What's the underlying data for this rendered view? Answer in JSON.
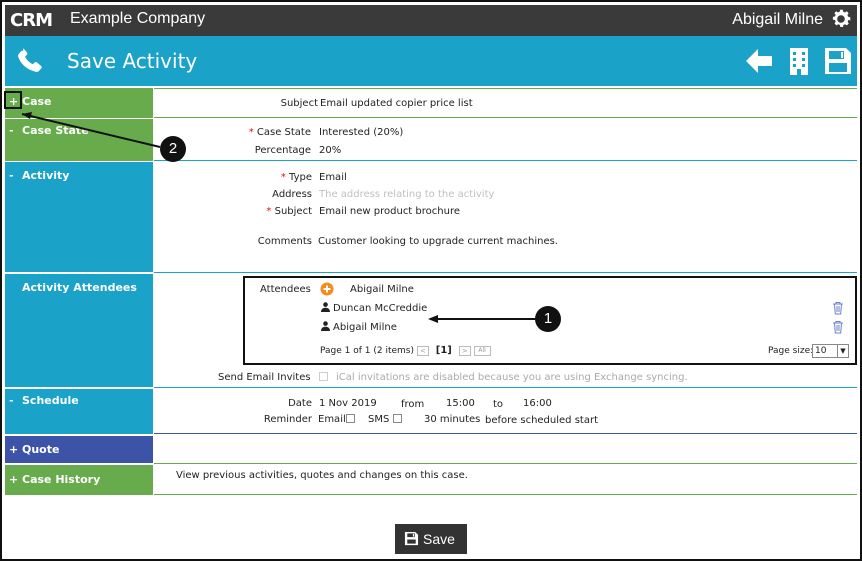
{
  "app": {
    "logo": "CRM",
    "company": "Example Company",
    "user": "Abigail Milne"
  },
  "header": {
    "title": "Save Activity"
  },
  "sections": {
    "case": {
      "sign": "+",
      "label": "Case"
    },
    "case_state": {
      "sign": "-",
      "label": "Case State"
    },
    "activity": {
      "sign": "-",
      "label": "Activity"
    },
    "attendees": {
      "label": "Activity Attendees"
    },
    "schedule": {
      "sign": "-",
      "label": "Schedule"
    },
    "quote": {
      "sign": "+",
      "label": "Quote"
    },
    "case_history": {
      "sign": "+",
      "label": "Case History"
    }
  },
  "case": {
    "subject_label": "Subject",
    "subject_value": "Email updated copier price list"
  },
  "case_state": {
    "state_label": "Case State",
    "state_value": "Interested (20%)",
    "percentage_label": "Percentage",
    "percentage_value": "20%"
  },
  "activity": {
    "type_label": "Type",
    "type_value": "Email",
    "address_label": "Address",
    "address_placeholder": "The address relating to the activity",
    "subject_label": "Subject",
    "subject_value": "Email new product brochure",
    "comments_label": "Comments",
    "comments_value": "Customer looking to upgrade current machines."
  },
  "attendees": {
    "label": "Attendees",
    "organizer": "Abigail Milne",
    "list": [
      "Duncan McCreddie",
      "Abigail Milne"
    ],
    "pager_text": "Page 1 of 1 (2 items)",
    "current_page": "[1]",
    "pager_prev": "<",
    "pager_next": ">",
    "pager_all": "All",
    "page_size_label": "Page size:",
    "page_size_value": "10",
    "send_invites_label": "Send Email Invites",
    "send_invites_note": "iCal invitations are disabled because you are using Exchange syncing."
  },
  "schedule": {
    "date_label": "Date",
    "date_value": "1 Nov 2019",
    "from_label": "from",
    "from_value": "15:00",
    "to_label": "to",
    "to_value": "16:00",
    "reminder_label": "Reminder",
    "email_label": "Email",
    "sms_label": "SMS",
    "minutes_value": "30 minutes",
    "before_text": "before scheduled start"
  },
  "case_history": {
    "text": "View previous activities, quotes and changes on this case."
  },
  "footer": {
    "save_label": "Save"
  },
  "callouts": {
    "one": "1",
    "two": "2"
  },
  "colors": {
    "green": "#67ab4d",
    "teal": "#1aa2c8",
    "indigo": "#3d53a8",
    "topbar": "#3a3a3a"
  }
}
